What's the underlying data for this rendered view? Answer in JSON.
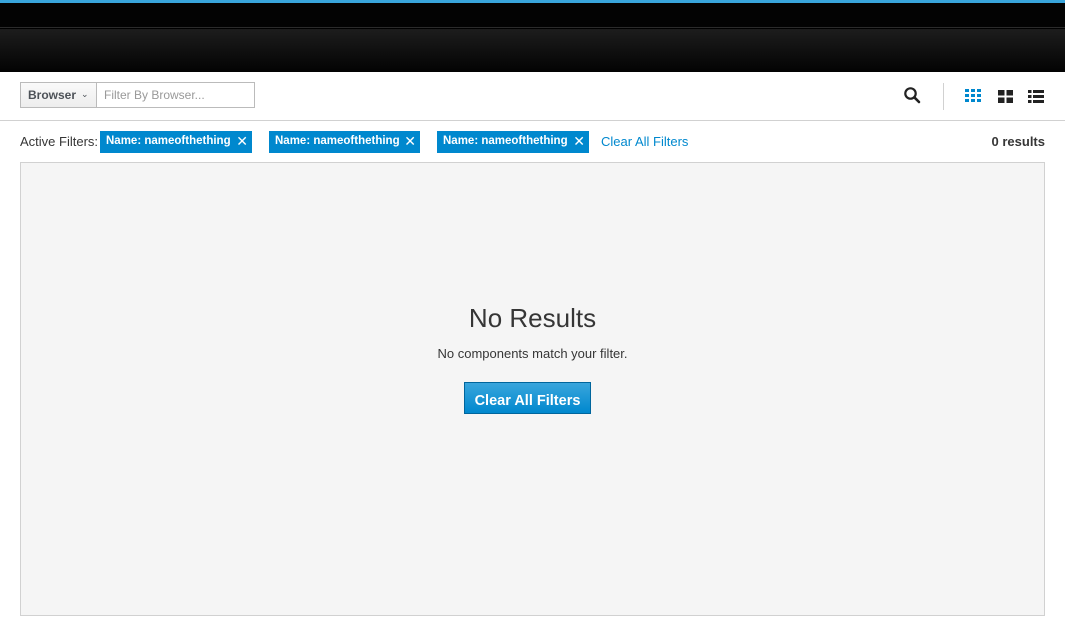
{
  "toolbar": {
    "filter_select_label": "Browser",
    "filter_input_placeholder": "Filter By Browser...",
    "search_icon": "search-icon",
    "view_icons": [
      "grid-small-icon",
      "grid-large-icon",
      "list-view-icon"
    ],
    "active_view": "grid-small-icon"
  },
  "filters": {
    "label": "Active Filters:",
    "chips": [
      {
        "label": "Name: nameofthething"
      },
      {
        "label": "Name: nameofthething"
      },
      {
        "label": "Name: nameofthething"
      }
    ],
    "clear_link": "Clear All Filters",
    "results_count": "0 results"
  },
  "empty_state": {
    "title": "No Results",
    "message": "No components match your filter.",
    "button_label": "Clear All Filters"
  },
  "colors": {
    "accent": "#0088ce",
    "chip_bg": "#0088ce",
    "button_bg": "#39a5dc",
    "active_view_icon": "#0088ce"
  }
}
